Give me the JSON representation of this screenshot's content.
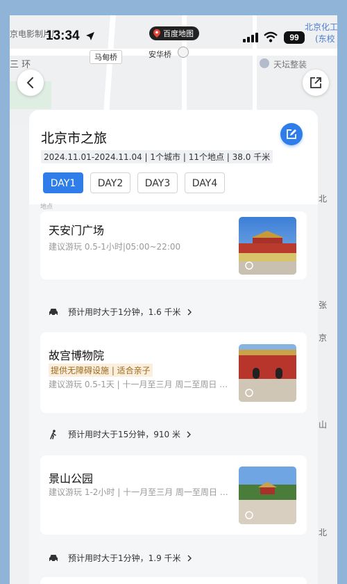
{
  "status_bar": {
    "time": "13:34",
    "battery": "99",
    "app_badge": "百度地图"
  },
  "map": {
    "labels": [
      "京电影制片厂",
      "三 环",
      "马甸桥",
      "安华桥",
      "天坛整装",
      "北京化工",
      "(东校"
    ],
    "right_edge_labels": [
      "北",
      "张",
      "京",
      "山",
      "北"
    ]
  },
  "trip": {
    "title": "北京市之旅",
    "meta": "2024.11.01-2024.11.04 | 1个城市 | 11个地点 | 38.0 千米",
    "days": [
      "DAY1",
      "DAY2",
      "DAY3",
      "DAY4"
    ],
    "active_day": "DAY1",
    "partial_label": "地点"
  },
  "pois": [
    {
      "name": "天安门广场",
      "info": "建议游玩 0.5-1小时|05:00~22:00",
      "tag": ""
    },
    {
      "name": "故宫博物院",
      "info": "建议游玩 0.5-1天 | 十一月至三月 周二至周日 开...",
      "tag": "提供无障碍设施 | 适合亲子"
    },
    {
      "name": "景山公园",
      "info": "建议游玩 1-2小时 | 十一月至三月 周一至周日 停...",
      "tag": ""
    }
  ],
  "segments": [
    {
      "mode_icon": "car-icon",
      "text": "预计用时大于1分钟，1.6 千米"
    },
    {
      "mode_icon": "walk-icon",
      "text": "预计用时大于15分钟，910 米"
    },
    {
      "mode_icon": "car-icon",
      "text": "预计用时大于1分钟，1.9 千米"
    }
  ],
  "colors": {
    "accent": "#2f7de9",
    "tag_bg": "#fbeedd",
    "tag_text": "#9a6b1e"
  }
}
